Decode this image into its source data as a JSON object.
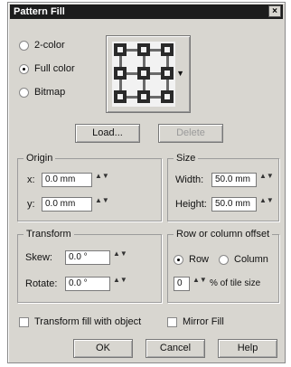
{
  "window": {
    "title": "Pattern Fill",
    "close": "×"
  },
  "pattern_type": {
    "options": [
      {
        "label": "2-color",
        "selected": false
      },
      {
        "label": "Full color",
        "selected": true
      },
      {
        "label": "Bitmap",
        "selected": false
      }
    ]
  },
  "pattern_picker": {
    "arrow": "▼"
  },
  "actions": {
    "load": "Load...",
    "delete": "Delete"
  },
  "origin": {
    "title": "Origin",
    "x_label": "x:",
    "x_value": "0.0 mm",
    "y_label": "y:",
    "y_value": "0.0 mm"
  },
  "size": {
    "title": "Size",
    "width_label": "Width:",
    "width_value": "50.0 mm",
    "height_label": "Height:",
    "height_value": "50.0 mm"
  },
  "transform": {
    "title": "Transform",
    "skew_label": "Skew:",
    "skew_value": "0.0 °",
    "rotate_label": "Rotate:",
    "rotate_value": "0.0 °"
  },
  "offset": {
    "title": "Row or column offset",
    "row_label": "Row",
    "row_selected": true,
    "column_label": "Column",
    "column_selected": false,
    "value": "0",
    "suffix": "% of tile size"
  },
  "options": {
    "transform_fill": "Transform fill with object",
    "mirror_fill": "Mirror Fill"
  },
  "footer": {
    "ok": "OK",
    "cancel": "Cancel",
    "help": "Help"
  },
  "spin_glyph": "▲▼"
}
